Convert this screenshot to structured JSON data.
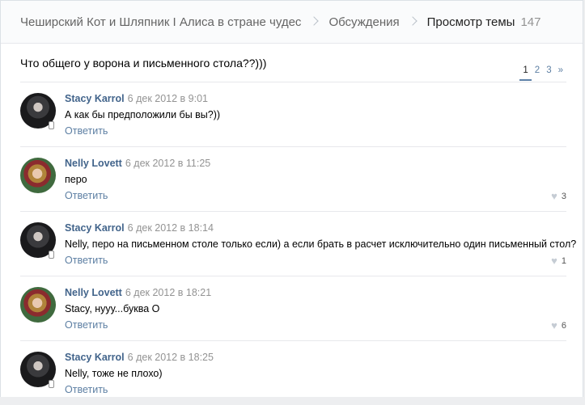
{
  "breadcrumb": {
    "group": "Чеширский Кот и Шляпник I Алиса в стране чудес",
    "discussions": "Обсуждения",
    "current": "Просмотр темы",
    "count": "147"
  },
  "topic": {
    "title": "Что общего у ворона и письменного стола??)))"
  },
  "pager": {
    "pages": [
      "1",
      "2",
      "3"
    ],
    "next": "»"
  },
  "reply_label": "Ответить",
  "posts": [
    {
      "author": "Stacy Karrol",
      "date": "6 дек 2012 в 9:01",
      "text": "А как бы предположили бы вы?))",
      "likes": ""
    },
    {
      "author": "Nelly Lovett",
      "date": "6 дек 2012 в 11:25",
      "text": "перо",
      "likes": "3"
    },
    {
      "author": "Stacy Karrol",
      "date": "6 дек 2012 в 18:14",
      "text": "Nelly, перо на письменном столе только если) а если брать в расчет исключительно один письменный стол?",
      "likes": "1"
    },
    {
      "author": "Nelly Lovett",
      "date": "6 дек 2012 в 18:21",
      "text": "Stacy, нууу...буква О",
      "likes": "6"
    },
    {
      "author": "Stacy Karrol",
      "date": "6 дек 2012 в 18:25",
      "text": "Nelly, тоже не плохо)",
      "likes": ""
    }
  ],
  "colors": {
    "link": "#42648b",
    "accent": "#5e81a8",
    "muted": "#939393"
  }
}
